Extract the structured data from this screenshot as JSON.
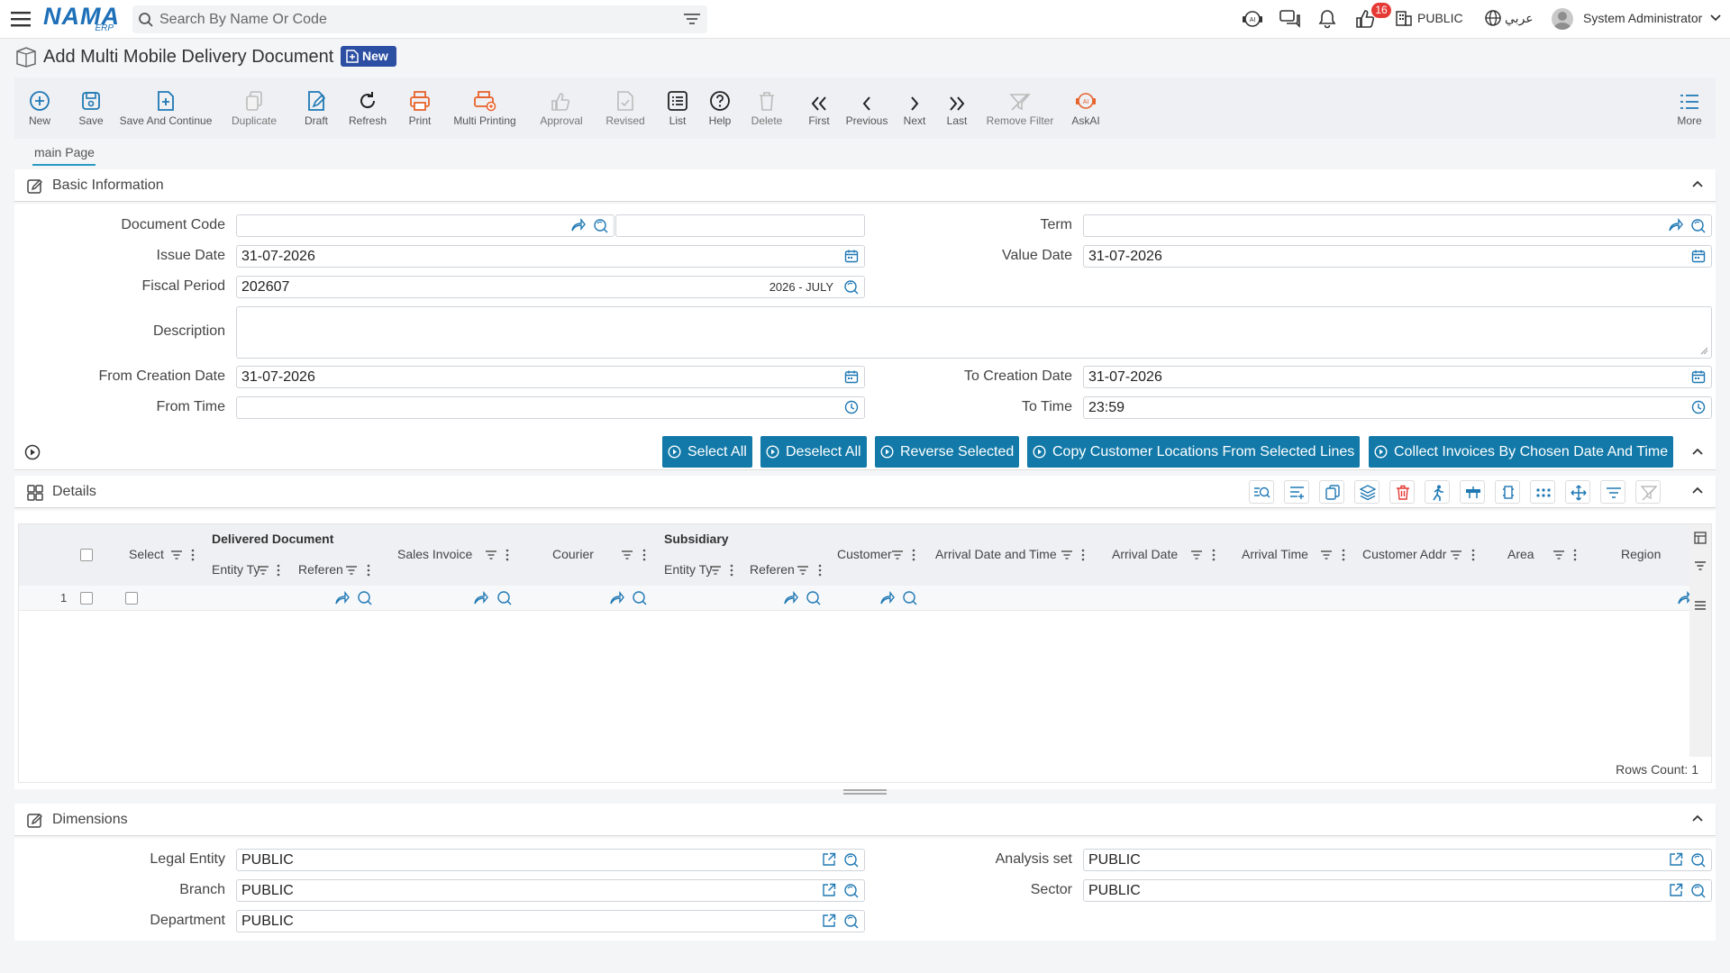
{
  "header": {
    "logo_text": "NAMA",
    "logo_sub": "ERP",
    "search_placeholder": "Search By Name Or Code",
    "notification_count": "16",
    "company": "PUBLIC",
    "language": "عربي",
    "user": "System Administrator"
  },
  "page": {
    "title": "Add Multi Mobile Delivery Document",
    "status_badge": "New"
  },
  "toolbar": {
    "buttons": [
      {
        "label": "New",
        "icon": "plus-circle-icon"
      },
      {
        "label": "Save",
        "icon": "save-icon"
      },
      {
        "label": "Save And Continue",
        "icon": "save-continue-icon"
      },
      {
        "label": "Duplicate",
        "icon": "duplicate-icon"
      },
      {
        "label": "Draft",
        "icon": "draft-icon"
      },
      {
        "label": "Refresh",
        "icon": "refresh-icon"
      },
      {
        "label": "Print",
        "icon": "print-icon"
      },
      {
        "label": "Multi Printing",
        "icon": "multi-print-icon"
      },
      {
        "label": "Approval",
        "icon": "thumbs-up-icon"
      },
      {
        "label": "Revised",
        "icon": "revised-icon"
      },
      {
        "label": "List",
        "icon": "list-icon"
      },
      {
        "label": "Help",
        "icon": "help-icon"
      },
      {
        "label": "Delete",
        "icon": "trash-icon"
      },
      {
        "label": "First",
        "icon": "double-chevron-left-icon"
      },
      {
        "label": "Previous",
        "icon": "chevron-left-icon"
      },
      {
        "label": "Next",
        "icon": "chevron-right-icon"
      },
      {
        "label": "Last",
        "icon": "double-chevron-right-icon"
      },
      {
        "label": "Remove Filter",
        "icon": "remove-filter-icon"
      },
      {
        "label": "AskAI",
        "icon": "ai-icon"
      }
    ],
    "more_label": "More"
  },
  "tabs": {
    "main": "main Page"
  },
  "basic_info": {
    "title": "Basic Information",
    "labels": {
      "document_code": "Document Code",
      "term": "Term",
      "issue_date": "Issue Date",
      "value_date": "Value Date",
      "fiscal_period": "Fiscal Period",
      "description": "Description",
      "from_creation_date": "From Creation Date",
      "to_creation_date": "To Creation Date",
      "from_time": "From Time",
      "to_time": "To Time"
    },
    "values": {
      "document_code": "",
      "document_code_extra": "",
      "term": "",
      "issue_date": "31-07-2026",
      "value_date": "31-07-2026",
      "fiscal_period": "202607",
      "fiscal_period_name": "2026 - JULY",
      "description": "",
      "from_creation_date": "31-07-2026",
      "to_creation_date": "31-07-2026",
      "from_time": "",
      "to_time": "23:59"
    }
  },
  "actions": {
    "select_all": "Select All",
    "deselect_all": "Deselect All",
    "reverse_selected": "Reverse Selected",
    "copy_locations": "Copy Customer Locations From Selected Lines",
    "collect_invoices": "Collect Invoices By Chosen Date And Time"
  },
  "details": {
    "title": "Details",
    "columns": {
      "select": "Select",
      "delivered_document": "Delivered Document",
      "entity_type": "Entity Ty",
      "reference": "Referen",
      "sales_invoice": "Sales Invoice",
      "courier": "Courier",
      "subsidiary": "Subsidiary",
      "sub_entity_type": "Entity Ty",
      "sub_reference": "Referen",
      "customer": "Customer",
      "arrival_date_time": "Arrival Date and Time",
      "arrival_date": "Arrival Date",
      "arrival_time": "Arrival Time",
      "customer_address": "Customer Addr",
      "area": "Area",
      "region": "Region"
    },
    "rows": [
      {
        "index": "1"
      }
    ],
    "rows_count": "Rows Count: 1"
  },
  "dimensions": {
    "title": "Dimensions",
    "labels": {
      "legal_entity": "Legal Entity",
      "analysis_set": "Analysis set",
      "branch": "Branch",
      "sector": "Sector",
      "department": "Department"
    },
    "values": {
      "legal_entity": "PUBLIC",
      "analysis_set": "PUBLIC",
      "branch": "PUBLIC",
      "sector": "PUBLIC",
      "department": "PUBLIC"
    }
  }
}
